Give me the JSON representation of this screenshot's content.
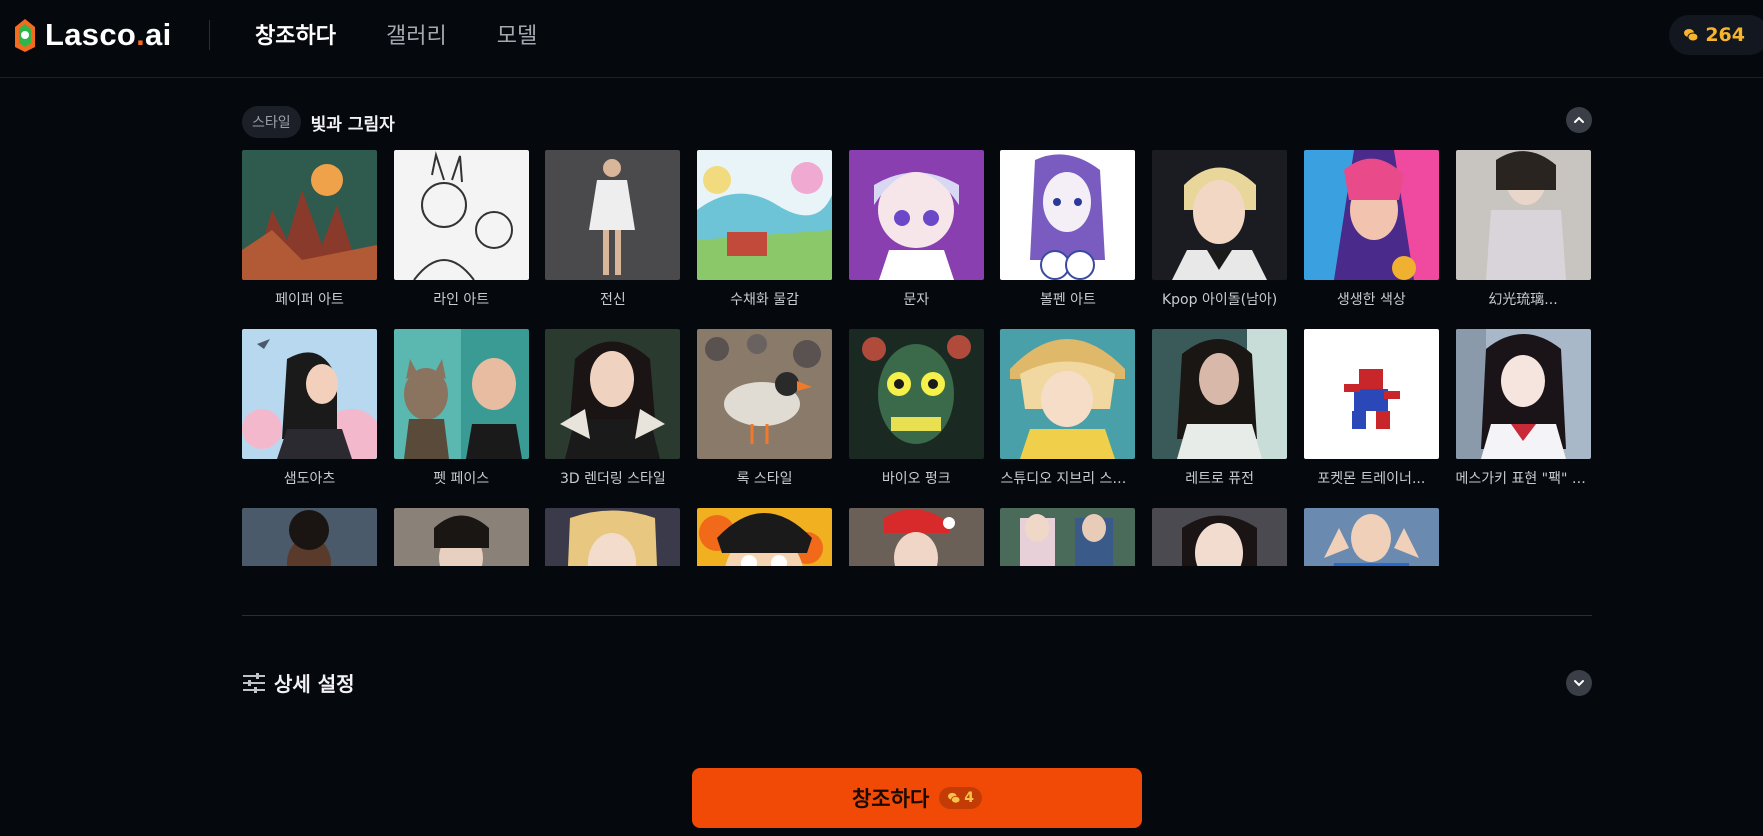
{
  "app": {
    "logo_text": "Lasco",
    "logo_dot": ".",
    "logo_suffix": "ai"
  },
  "nav": [
    {
      "label": "창조하다",
      "active": true
    },
    {
      "label": "갤러리"
    },
    {
      "label": "모델"
    }
  ],
  "credits": {
    "value": "264"
  },
  "style_section": {
    "tag": "스타일",
    "title": "빛과 그림자",
    "items": [
      {
        "label": "페이퍼 아트"
      },
      {
        "label": "라인 아트"
      },
      {
        "label": "전신"
      },
      {
        "label": "수채화 물감"
      },
      {
        "label": "문자"
      },
      {
        "label": "볼펜 아트"
      },
      {
        "label": "Kpop 아이돌(남아)"
      },
      {
        "label": "생생한 색상"
      },
      {
        "label": "幻光琉璃..."
      },
      {
        "label": "샘도아츠"
      },
      {
        "label": "펫 페이스"
      },
      {
        "label": "3D 렌더링 스타일"
      },
      {
        "label": "록 스타일"
      },
      {
        "label": "바이오 펑크"
      },
      {
        "label": "스튜디오 지브리 스타..."
      },
      {
        "label": "레트로 퓨전"
      },
      {
        "label": "포켓몬 트레이너..."
      },
      {
        "label": "메스가키 표현 \"팩\" 컨..."
      },
      {
        "label": ""
      },
      {
        "label": ""
      },
      {
        "label": ""
      },
      {
        "label": ""
      },
      {
        "label": ""
      },
      {
        "label": ""
      },
      {
        "label": ""
      },
      {
        "label": ""
      }
    ]
  },
  "advanced": {
    "title": "상세 설정"
  },
  "create_button": {
    "label": "창조하다",
    "cost": "4"
  },
  "colors": {
    "accent": "#f04a06",
    "coin": "#f8b52c",
    "background": "#05080d"
  }
}
